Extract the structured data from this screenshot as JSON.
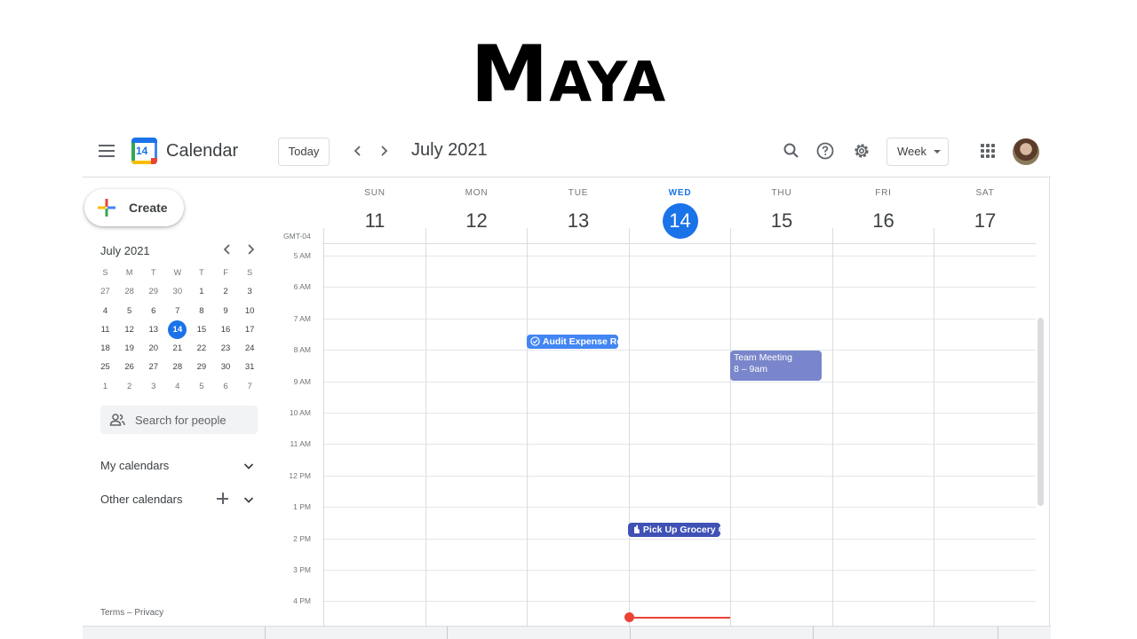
{
  "slide": {
    "title_initial": "M",
    "title_rest": "AYA"
  },
  "header": {
    "app_name": "Calendar",
    "logo_day": "14",
    "today_label": "Today",
    "prev_icon": "chevron-left-icon",
    "next_icon": "chevron-right-icon",
    "month_title": "July 2021",
    "view_label": "Week",
    "icons": [
      "menu-icon",
      "search-icon",
      "help-icon",
      "settings-icon",
      "apps-grid-icon",
      "avatar"
    ]
  },
  "sidebar": {
    "create_label": "Create",
    "mini_calendar": {
      "title": "July 2021",
      "weekday_heads": [
        "S",
        "M",
        "T",
        "W",
        "T",
        "F",
        "S"
      ],
      "weeks": [
        [
          "27",
          "28",
          "29",
          "30",
          "1",
          "2",
          "3"
        ],
        [
          "4",
          "5",
          "6",
          "7",
          "8",
          "9",
          "10"
        ],
        [
          "11",
          "12",
          "13",
          "14",
          "15",
          "16",
          "17"
        ],
        [
          "18",
          "19",
          "20",
          "21",
          "22",
          "23",
          "24"
        ],
        [
          "25",
          "26",
          "27",
          "28",
          "29",
          "30",
          "31"
        ],
        [
          "1",
          "2",
          "3",
          "4",
          "5",
          "6",
          "7"
        ]
      ],
      "today": "14"
    },
    "search_people_placeholder": "Search for people",
    "my_calendars_label": "My calendars",
    "other_calendars_label": "Other calendars",
    "terms_label": "Terms",
    "separator": "–",
    "privacy_label": "Privacy"
  },
  "week": {
    "timezone": "GMT-04",
    "days": [
      {
        "dow": "SUN",
        "num": "11",
        "today": false
      },
      {
        "dow": "MON",
        "num": "12",
        "today": false
      },
      {
        "dow": "TUE",
        "num": "13",
        "today": false
      },
      {
        "dow": "WED",
        "num": "14",
        "today": true
      },
      {
        "dow": "THU",
        "num": "15",
        "today": false
      },
      {
        "dow": "FRI",
        "num": "16",
        "today": false
      },
      {
        "dow": "SAT",
        "num": "17",
        "today": false
      }
    ],
    "hours": [
      "5 AM",
      "6 AM",
      "7 AM",
      "8 AM",
      "9 AM",
      "10 AM",
      "11 AM",
      "12 PM",
      "1 PM",
      "2 PM",
      "3 PM",
      "4 PM"
    ]
  },
  "events": {
    "audit": {
      "title": "Audit Expense Re",
      "color": "#4285f4",
      "icon": "task-check-icon"
    },
    "team": {
      "title": "Team Meeting",
      "time": "8 – 9am",
      "color": "#7986cb"
    },
    "grocery": {
      "title": "Pick Up Grocery O",
      "color": "#3f51b5",
      "icon": "hand-icon"
    }
  },
  "colors": {
    "accent": "#1a73e8",
    "now_indicator": "#ea4335"
  }
}
